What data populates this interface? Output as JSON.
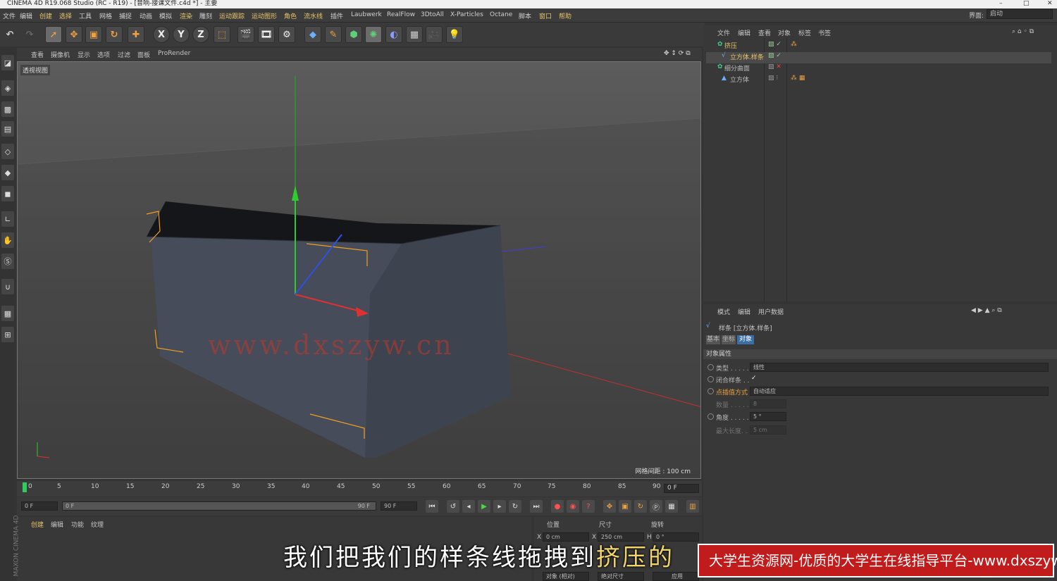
{
  "window": {
    "title": "CINEMA 4D R19.068 Studio (RC - R19) - [音响-接课文件.c4d *] - 主要",
    "controls": [
      "–",
      "□",
      "✕"
    ]
  },
  "menu": {
    "items": [
      "文件",
      "编辑",
      "创建",
      "选择",
      "工具",
      "网格",
      "捕捉",
      "动画",
      "模拟",
      "渲染",
      "雕刻",
      "运动跟踪",
      "运动图形",
      "角色",
      "流水线",
      "插件",
      "Laubwerk",
      "RealFlow",
      "3DtoAll",
      "X-Particles",
      "Octane",
      "脚本",
      "窗口",
      "帮助"
    ],
    "layout_label": "界面:",
    "layout_value": "启动"
  },
  "toolbar": {
    "axis_x": "X",
    "axis_y": "Y",
    "axis_z": "Z"
  },
  "viewport": {
    "menu": [
      "查看",
      "摄像机",
      "显示",
      "选项",
      "过滤",
      "面板",
      "ProRender"
    ],
    "label": "透视视图",
    "grid_info": "网格间距 : 100 cm",
    "watermark": "www.dxszyw.cn"
  },
  "timeline": {
    "ticks": [
      "0",
      "5",
      "10",
      "15",
      "20",
      "25",
      "30",
      "35",
      "40",
      "45",
      "50",
      "55",
      "60",
      "65",
      "70",
      "75",
      "80",
      "85",
      "90"
    ],
    "current_frame": "0 F"
  },
  "playback": {
    "start": "0 F",
    "range_start": "0 F",
    "range_end": "90 F",
    "end": "90 F"
  },
  "materials": {
    "menu": [
      "创建",
      "编辑",
      "功能",
      "纹理"
    ],
    "side_logo": "MAXON CINEMA 4D"
  },
  "coordinates": {
    "headers": [
      "位置",
      "尺寸",
      "旋转"
    ],
    "x_label": "X",
    "x_pos": "0 cm",
    "x_size_label": "X",
    "x_size": "250 cm",
    "h_label": "H",
    "h_rot": "0 °",
    "mode_object": "对象 (相对)",
    "mode_size": "绝对尺寸",
    "apply": "应用"
  },
  "object_manager": {
    "menu": [
      "文件",
      "编辑",
      "查看",
      "对象",
      "标签",
      "书签"
    ],
    "items": [
      {
        "name": "挤压",
        "color": "#e6c46a"
      },
      {
        "name": "立方体.样条",
        "color": "#e6c46a"
      },
      {
        "name": "细分曲面",
        "color": "#bbbbbb"
      },
      {
        "name": "立方体",
        "color": "#bbbbbb"
      }
    ]
  },
  "attributes": {
    "menu": [
      "模式",
      "编辑",
      "用户数据"
    ],
    "object_title": "样条 [立方体.样条]",
    "tabs": [
      "基本",
      "坐标",
      "对象"
    ],
    "section": "对象属性",
    "rows": [
      {
        "label": "类型 . . . . .",
        "value": "线性"
      },
      {
        "label": "闭合样条 . .",
        "value": "✓"
      },
      {
        "label": "点插值方式",
        "value": "自动适应"
      },
      {
        "label": "数量 . . . . .",
        "value": "8"
      },
      {
        "label": "角度 . . . . .",
        "value": "5 °"
      },
      {
        "label": "最大长度. . .",
        "value": "5 cm"
      }
    ]
  },
  "subtitle": {
    "text": "我们把我们的样条线拖拽到",
    "highlight": "挤压的"
  },
  "banner": {
    "text": "大学生资源网-优质的大学生在线指导平台-www.dxszyw.cn"
  }
}
